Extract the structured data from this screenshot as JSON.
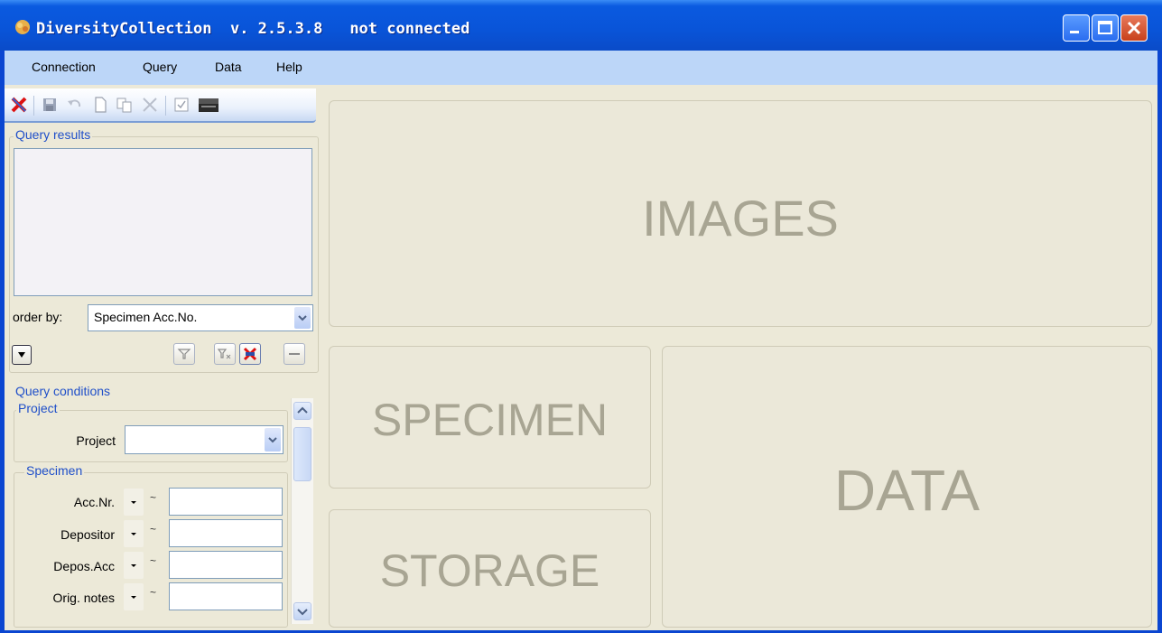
{
  "window": {
    "app_name": "DiversityCollection",
    "version": "v. 2.5.3.8",
    "status": "not connected",
    "controls": {
      "minimize": "minimize",
      "maximize": "maximize",
      "close": "close"
    }
  },
  "menu": [
    {
      "label": "Connection"
    },
    {
      "label": "Query"
    },
    {
      "label": "Data"
    },
    {
      "label": "Help"
    }
  ],
  "toolbar": {
    "icons": [
      "disconnect-icon",
      "save-icon",
      "undo-icon",
      "new-icon",
      "copy-icon",
      "delete-icon",
      "checkbox-icon",
      "print-icon"
    ]
  },
  "query_results": {
    "title": "Query results",
    "order_by_label": "order by:",
    "order_by_value": "Specimen Acc.No."
  },
  "query_conditions": {
    "title": "Query conditions",
    "project_group": "Project",
    "project_label": "Project",
    "project_value": "",
    "specimen_group": "Specimen",
    "fields": [
      {
        "label": "Acc.Nr.",
        "operator": "~",
        "value": ""
      },
      {
        "label": "Depositor",
        "operator": "~",
        "value": ""
      },
      {
        "label": "Depos.Acc",
        "operator": "~",
        "value": ""
      },
      {
        "label": "Orig. notes",
        "operator": "~",
        "value": ""
      }
    ]
  },
  "panels": {
    "images": "IMAGES",
    "specimen": "SPECIMEN",
    "storage": "STORAGE",
    "data": "DATA"
  },
  "colors": {
    "title_bar": "#0a54d6",
    "menu_bar": "#bcd6f8",
    "panel_bg": "#ebe8d9",
    "panel_text": "#a8a593",
    "group_label": "#1f4fc9"
  }
}
